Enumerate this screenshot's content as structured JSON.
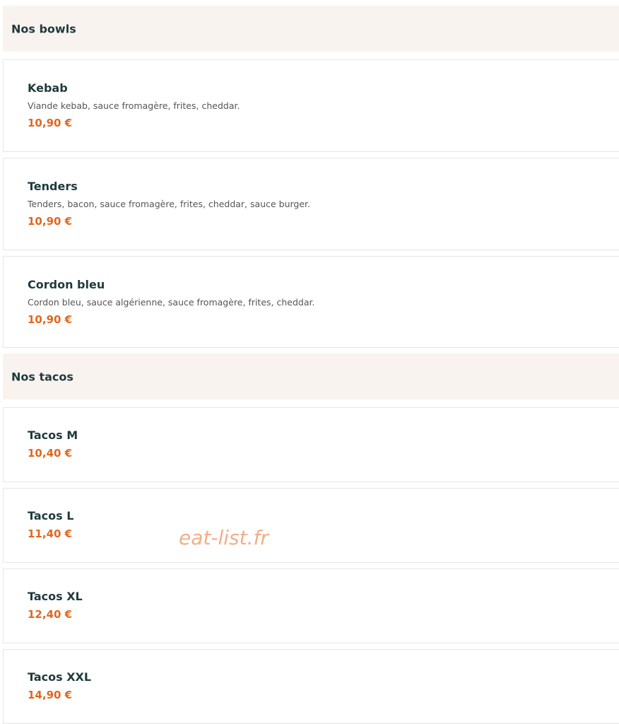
{
  "sections": [
    {
      "title": "Nos bowls",
      "items": [
        {
          "name": "Kebab",
          "description": "Viande kebab, sauce fromagère, frites, cheddar.",
          "price": "10,90 €"
        },
        {
          "name": "Tenders",
          "description": "Tenders, bacon, sauce fromagère, frites, cheddar, sauce burger.",
          "price": "10,90 €"
        },
        {
          "name": "Cordon bleu",
          "description": "Cordon bleu, sauce algérienne, sauce fromagère, frites, cheddar.",
          "price": "10,90 €"
        }
      ]
    },
    {
      "title": "Nos tacos",
      "items": [
        {
          "name": "Tacos M",
          "price": "10,40 €"
        },
        {
          "name": "Tacos L",
          "price": "11,40 €"
        },
        {
          "name": "Tacos XL",
          "price": "12,40 €"
        },
        {
          "name": "Tacos XXL",
          "price": "14,90 €"
        }
      ]
    }
  ],
  "watermark": "eat-list.fr",
  "colors": {
    "header_bg": "#f9f3f0",
    "text_dark": "#1f3a3d",
    "price": "#e06820",
    "watermark": "#f0a070"
  }
}
